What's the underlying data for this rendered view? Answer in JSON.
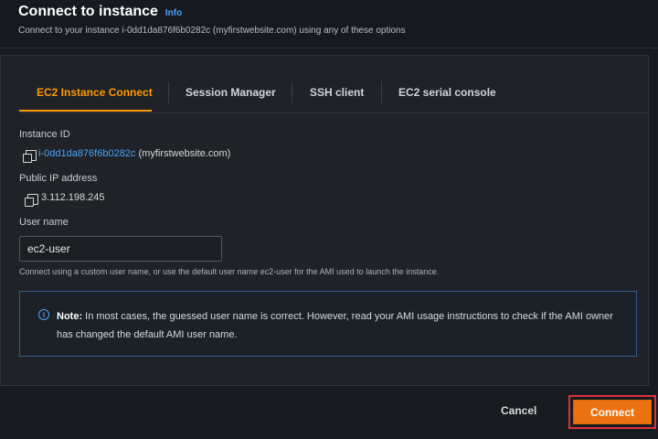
{
  "header": {
    "title": "Connect to instance",
    "info_link": "Info",
    "subtitle": "Connect to your instance i-0dd1da876f6b0282c (myfirstwebsite.com) using any of these options"
  },
  "tabs": [
    {
      "label": "EC2 Instance Connect",
      "active": true
    },
    {
      "label": "Session Manager",
      "active": false
    },
    {
      "label": "SSH client",
      "active": false
    },
    {
      "label": "EC2 serial console",
      "active": false
    }
  ],
  "instance": {
    "id_label": "Instance ID",
    "id_link": "i-0dd1da876f6b0282c",
    "id_suffix": " (myfirstwebsite.com)",
    "ip_label": "Public IP address",
    "ip_value": "3.112.198.245"
  },
  "user": {
    "label": "User name",
    "value": "ec2-user",
    "hint": "Connect using a custom user name, or use the default user name ec2-user for the AMI used to launch the instance."
  },
  "note": {
    "prefix": "Note:",
    "text": " In most cases, the guessed user name is correct. However, read your AMI usage instructions to check if the AMI owner has changed the default AMI user name."
  },
  "footer": {
    "cancel_label": "Cancel",
    "connect_label": "Connect"
  },
  "colors": {
    "accent": "#ff9900",
    "primary_button": "#ec7211",
    "link": "#4da3ff",
    "highlight_border": "#e0303a"
  }
}
